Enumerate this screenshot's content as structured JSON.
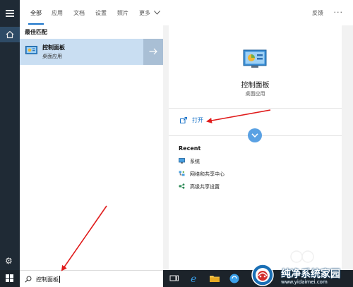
{
  "tabs": [
    {
      "label": "全部"
    },
    {
      "label": "应用"
    },
    {
      "label": "文档"
    },
    {
      "label": "设置"
    },
    {
      "label": "照片"
    },
    {
      "label": "更多"
    }
  ],
  "header": {
    "feedback_label": "反馈"
  },
  "results": {
    "section_title": "最佳匹配",
    "best_match": {
      "title": "控制面板",
      "subtitle": "桌面应用"
    }
  },
  "detail": {
    "title": "控制面板",
    "subtitle": "桌面应用",
    "open_label": "打开",
    "recent_title": "Recent",
    "recent_items": [
      {
        "label": "系统",
        "icon": "monitor-icon"
      },
      {
        "label": "网络和共享中心",
        "icon": "network-icon"
      },
      {
        "label": "高级共享设置",
        "icon": "sharing-icon"
      }
    ]
  },
  "search": {
    "query": "控制面板"
  },
  "watermark": {
    "title": "纯净系统家园",
    "url": "www.yidaimei.com"
  },
  "colors": {
    "accent": "#1a73c9",
    "selected_bg": "#c9def2",
    "annotation": "#e01b1b",
    "taskbar": "#1c232a"
  }
}
